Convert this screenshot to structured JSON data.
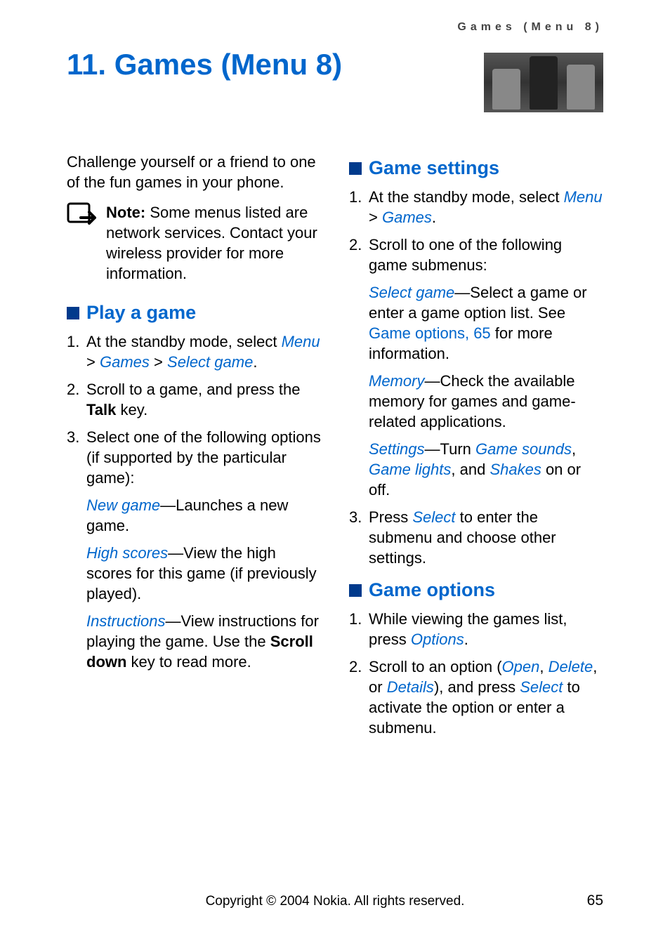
{
  "running_head": "Games (Menu 8)",
  "title": "11. Games (Menu 8)",
  "intro": "Challenge yourself or a friend to one of the fun games in your phone.",
  "note": {
    "label": "Note:",
    "text": " Some menus listed are network services. Contact your wireless provider for more information."
  },
  "play": {
    "heading": "Play a game",
    "steps": [
      {
        "num": "1.",
        "pre": "At the standby mode, select ",
        "path": [
          "Menu",
          ">",
          "Games",
          ">",
          "Select game"
        ],
        "post": "."
      },
      {
        "num": "2.",
        "pre": "Scroll to a game, and press the ",
        "bold": "Talk",
        "post": " key."
      },
      {
        "num": "3.",
        "pre": "Select one of the following options (if supported by the particular game):"
      }
    ],
    "subs": [
      {
        "term": "New game",
        "desc": "—Launches a new game."
      },
      {
        "term": "High scores",
        "desc": "—View the high scores for this game (if previously played)."
      },
      {
        "term": "Instructions",
        "desc_pre": "—View instructions for playing the game. Use the ",
        "bold": "Scroll down",
        "desc_post": " key to read more."
      }
    ]
  },
  "settings": {
    "heading": "Game settings",
    "steps": [
      {
        "num": "1.",
        "pre": "At the standby mode, select ",
        "path": [
          "Menu",
          ">",
          "Games"
        ],
        "post": "."
      },
      {
        "num": "2.",
        "pre": "Scroll to one of the following game submenus:"
      }
    ],
    "subs": [
      {
        "term": "Select game",
        "desc_pre": "—Select a game or enter a game option list. See ",
        "link": "Game options, 65",
        "desc_post": " for more information."
      },
      {
        "term": "Memory",
        "desc": "—Check the available memory for games and game-related applications."
      },
      {
        "term": "Settings",
        "desc_pre": "—Turn ",
        "em1": "Game sounds",
        "mid1": ", ",
        "em2": "Game lights",
        "mid2": ", and ",
        "em3": "Shakes",
        "desc_post": " on or off."
      }
    ],
    "step3": {
      "num": "3.",
      "pre": "Press ",
      "em": "Select",
      "post": " to enter the submenu and choose other settings."
    }
  },
  "options": {
    "heading": "Game options",
    "steps": [
      {
        "num": "1.",
        "pre": "While viewing the games list, press ",
        "em": "Options",
        "post": "."
      },
      {
        "num": "2.",
        "pre": "Scroll to an option (",
        "em1": "Open",
        "mid1": ", ",
        "em2": "Delete",
        "mid2": ", or ",
        "em3": "Details",
        "post1": "), and press ",
        "em4": "Select",
        "post2": " to activate the option or enter a submenu."
      }
    ]
  },
  "footer": "Copyright © 2004 Nokia. All rights reserved.",
  "page_number": "65"
}
